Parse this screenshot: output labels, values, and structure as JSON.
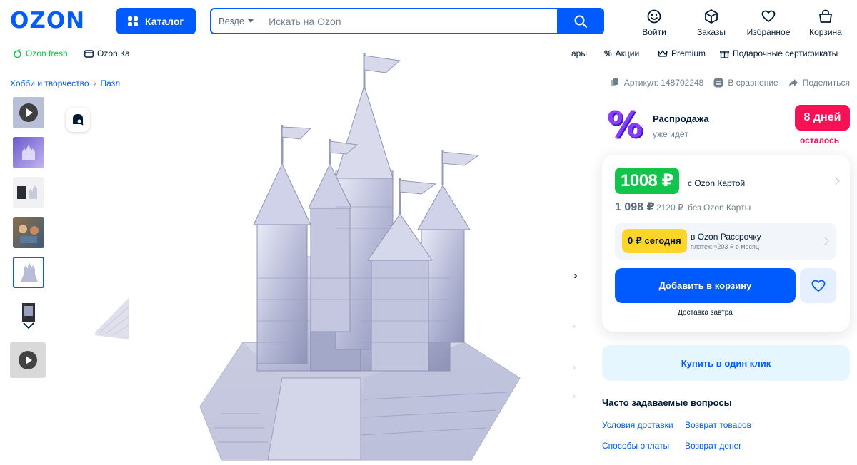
{
  "header": {
    "logo": "OZON",
    "catalog_label": "Каталог",
    "search_scope": "Везде",
    "search_placeholder": "Искать на Ozon",
    "actions": [
      {
        "label": "Войти",
        "icon": "smile-icon"
      },
      {
        "label": "Заказы",
        "icon": "box-icon"
      },
      {
        "label": "Избранное",
        "icon": "heart-icon"
      },
      {
        "label": "Корзина",
        "icon": "cart-icon"
      }
    ]
  },
  "subnav": {
    "fresh": "Ozon fresh",
    "card": "Ozon Ка",
    "cut": "ары",
    "promo": "Акции",
    "premium": "Premium",
    "gift": "Подарочные сертификаты"
  },
  "breadcrumb": [
    "Хобби и творчество",
    "Пазл"
  ],
  "meta": {
    "article": "Артикул: 148702248",
    "compare": "В сравнение",
    "share": "Поделиться"
  },
  "sale": {
    "title": "Распродажа",
    "subtitle": "уже идёт",
    "days": "8 дней",
    "days_left": "осталось"
  },
  "price_card": {
    "card_price": "1008 ₽",
    "card_price_label": "с Ozon Картой",
    "price": "1 098 ₽",
    "old_price": "2120 ₽",
    "price_label": "без Ozon Карты",
    "installment_badge": "0 ₽ сегодня",
    "installment_title": "в Ozon Рассрочку",
    "installment_sub": "платеж ≈203 ₽ в месяц",
    "add_to_cart": "Добавить в корзину",
    "delivery": "Доставка завтра"
  },
  "oneclick": "Купить в один клик",
  "faq": {
    "title": "Часто задаваемые вопросы",
    "links": [
      "Условия доставки",
      "Возврат товаров",
      "Способы оплаты",
      "Возврат денег"
    ]
  },
  "colors": {
    "brand": "#005bff",
    "green": "#10c44c",
    "pink": "#f91155",
    "yellow": "#ffd52a"
  }
}
